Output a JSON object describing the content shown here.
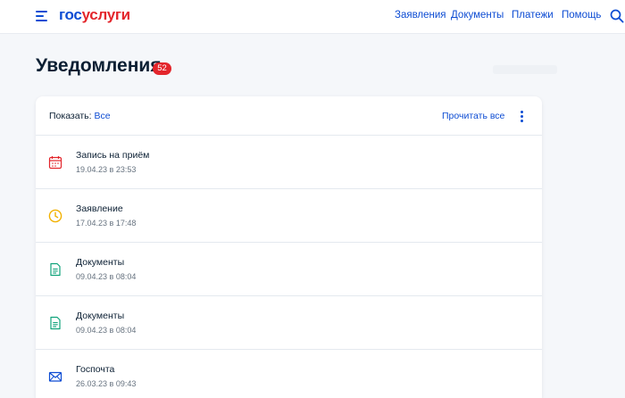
{
  "header": {
    "logo_part1": "гос",
    "logo_part2": "услуги",
    "nav": [
      "Заявления",
      "Документы",
      "Платежи",
      "Помощь"
    ],
    "menu_icon": "burger-menu-icon",
    "search_icon": "search-icon"
  },
  "page": {
    "title": "Уведомления",
    "count": "52"
  },
  "toolbar": {
    "filter_label": "Показать:",
    "filter_value": "Все",
    "read_all": "Прочитать все",
    "more_icon": "kebab-menu-icon"
  },
  "notifications": [
    {
      "title": "Запись на приём",
      "date": "19.04.23 в 23:53",
      "icon": "calendar-icon",
      "color": "#e3262c"
    },
    {
      "title": "Заявление",
      "date": "17.04.23 в 17:48",
      "icon": "clock-icon",
      "color": "#f2b100"
    },
    {
      "title": "Документы",
      "date": "09.04.23 в 08:04",
      "icon": "document-icon",
      "color": "#10a37b"
    },
    {
      "title": "Документы",
      "date": "09.04.23 в 08:04",
      "icon": "document-icon",
      "color": "#10a37b"
    },
    {
      "title": "Госпочта",
      "date": "26.03.23 в 09:43",
      "icon": "envelope-icon",
      "color": "#0d4cd3"
    }
  ],
  "colors": {
    "brand_blue": "#0d4cd3",
    "brand_red": "#e3262c",
    "page_bg": "#f5f7fa",
    "text": "#0b1f33",
    "muted": "#66727f"
  }
}
